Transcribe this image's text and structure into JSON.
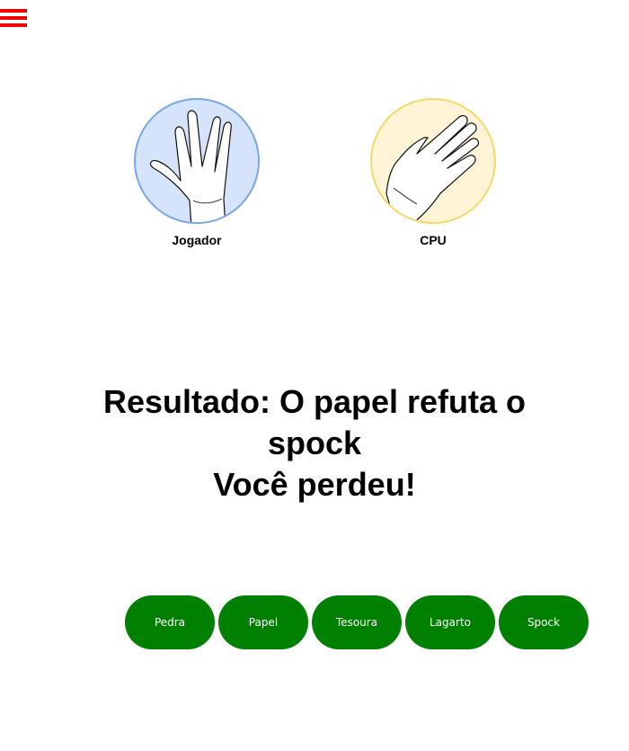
{
  "menu": {
    "icon": "hamburger-menu-icon",
    "color": "#ee0000"
  },
  "players": {
    "jogador": {
      "label": "Jogador",
      "choice_icon": "spock-hand-icon",
      "circle_fill": "#d6e4fb",
      "circle_border": "#7aa7e6"
    },
    "cpu": {
      "label": "CPU",
      "choice_icon": "paper-hand-icon",
      "circle_fill": "#fff4d6",
      "circle_border": "#f3d86a"
    }
  },
  "result": {
    "line1": "Resultado: O papel refuta o spock",
    "line2": "Você perdeu!"
  },
  "choices": {
    "color": "#008000",
    "items": [
      {
        "label": "Pedra"
      },
      {
        "label": "Papel"
      },
      {
        "label": "Tesoura"
      },
      {
        "label": "Lagarto"
      },
      {
        "label": "Spock"
      }
    ]
  }
}
